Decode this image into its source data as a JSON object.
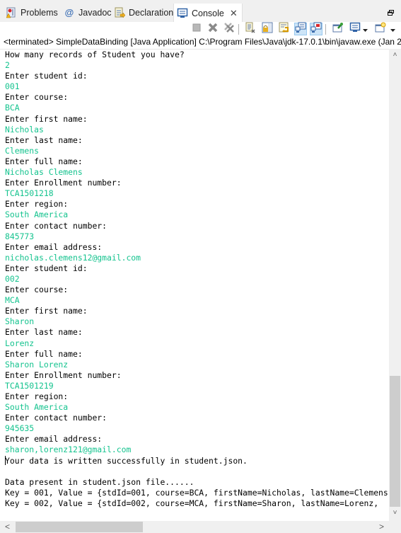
{
  "tabs": [
    {
      "label": "Problems",
      "icon": "problems-icon",
      "active": false
    },
    {
      "label": "Javadoc",
      "icon": "at-sign-icon",
      "active": false
    },
    {
      "label": "Declaration",
      "icon": "declaration-icon",
      "active": false
    },
    {
      "label": "Console",
      "icon": "console-icon",
      "active": true
    }
  ],
  "tab_close_glyph": "✕",
  "toolbar": {
    "buttons": [
      {
        "name": "terminate-button",
        "icon": "stop-icon"
      },
      {
        "name": "remove-launch-button",
        "icon": "remove-icon"
      },
      {
        "name": "remove-all-terminated-button",
        "icon": "remove-all-icon"
      },
      {
        "name": "clear-console-button",
        "icon": "clear-console-icon"
      },
      {
        "name": "scroll-lock-button",
        "icon": "scroll-lock-icon"
      },
      {
        "name": "word-wrap-button",
        "icon": "word-wrap-icon"
      },
      {
        "name": "show-on-stdout-button",
        "icon": "show-stdout-icon",
        "pressed": true
      },
      {
        "name": "show-on-stderr-button",
        "icon": "show-stderr-icon",
        "pressed": true
      },
      {
        "name": "pin-console-button",
        "icon": "pin-icon"
      },
      {
        "name": "display-console-button",
        "icon": "display-console-icon"
      },
      {
        "name": "open-console-button",
        "icon": "new-console-icon"
      }
    ]
  },
  "status_line": "<terminated> SimpleDataBinding [Java Application] C:\\Program Files\\Java\\jdk-17.0.1\\bin\\javaw.exe  (Jan 2",
  "colors": {
    "stdout": "#000000",
    "stdin": "#14c38e",
    "selected_toggle": "#cce4f7"
  },
  "console_lines": [
    {
      "text": "How many records of Student you have?",
      "type": "out"
    },
    {
      "text": "2",
      "type": "in"
    },
    {
      "text": "Enter student id:",
      "type": "out"
    },
    {
      "text": "001",
      "type": "in"
    },
    {
      "text": "Enter course:",
      "type": "out"
    },
    {
      "text": "BCA",
      "type": "in"
    },
    {
      "text": "Enter first name:",
      "type": "out"
    },
    {
      "text": "Nicholas",
      "type": "in"
    },
    {
      "text": "Enter last name:",
      "type": "out"
    },
    {
      "text": "Clemens",
      "type": "in"
    },
    {
      "text": "Enter full name:",
      "type": "out"
    },
    {
      "text": "Nicholas Clemens",
      "type": "in"
    },
    {
      "text": "Enter Enrollment number:",
      "type": "out"
    },
    {
      "text": "TCA1501218",
      "type": "in"
    },
    {
      "text": "Enter region:",
      "type": "out"
    },
    {
      "text": "South America",
      "type": "in"
    },
    {
      "text": "Enter contact number:",
      "type": "out"
    },
    {
      "text": "845773",
      "type": "in"
    },
    {
      "text": "Enter email address:",
      "type": "out"
    },
    {
      "text": "nicholas.clemens12@gmail.com",
      "type": "in"
    },
    {
      "text": "Enter student id:",
      "type": "out"
    },
    {
      "text": "002",
      "type": "in"
    },
    {
      "text": "Enter course:",
      "type": "out"
    },
    {
      "text": "MCA",
      "type": "in"
    },
    {
      "text": "Enter first name:",
      "type": "out"
    },
    {
      "text": "Sharon",
      "type": "in"
    },
    {
      "text": "Enter last name:",
      "type": "out"
    },
    {
      "text": "Lorenz",
      "type": "in"
    },
    {
      "text": "Enter full name:",
      "type": "out"
    },
    {
      "text": "Sharon Lorenz",
      "type": "in"
    },
    {
      "text": "Enter Enrollment number:",
      "type": "out"
    },
    {
      "text": "TCA1501219",
      "type": "in"
    },
    {
      "text": "Enter region:",
      "type": "out"
    },
    {
      "text": "South America",
      "type": "in"
    },
    {
      "text": "Enter contact number:",
      "type": "out"
    },
    {
      "text": "945635",
      "type": "in"
    },
    {
      "text": "Enter email address:",
      "type": "out"
    },
    {
      "text": "sharon,lorenz121@gmail.com",
      "type": "in"
    },
    {
      "text": "Your data is written successfully in student.json.",
      "type": "out",
      "cursor": true
    },
    {
      "text": "",
      "type": "out"
    },
    {
      "text": "Data present in student.json file......",
      "type": "out"
    },
    {
      "text": "Key = 001, Value = {stdId=001, course=BCA, firstName=Nicholas, lastName=Clemens",
      "type": "out"
    },
    {
      "text": "Key = 002, Value = {stdId=002, course=MCA, firstName=Sharon, lastName=Lorenz, ",
      "type": "out"
    }
  ],
  "scrollbars": {
    "vertical": {
      "up_glyph": "˄",
      "down_glyph": "˅",
      "position_fraction": 1.0
    },
    "horizontal": {
      "left_glyph": "<",
      "right_glyph": ">",
      "position_fraction": 0.0
    }
  }
}
